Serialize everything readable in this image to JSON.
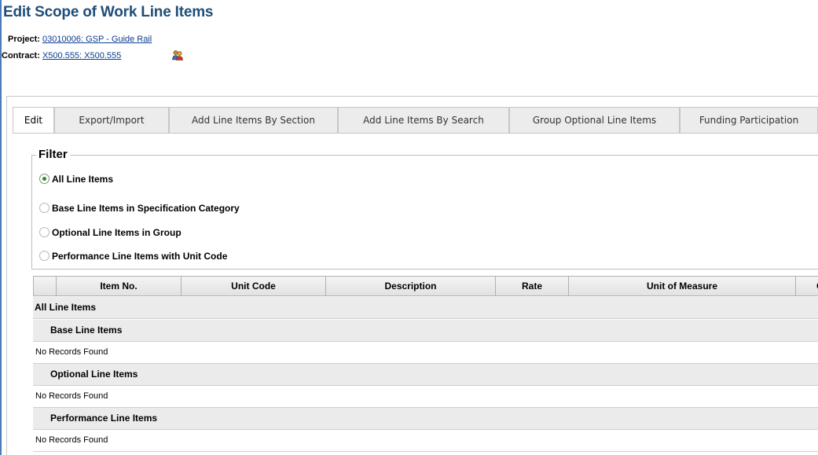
{
  "page": {
    "title": "Edit Scope of Work Line Items"
  },
  "project": {
    "label": "Project:",
    "value": "03010006: GSP - Guide Rail"
  },
  "contract": {
    "label": "Contract:",
    "value": "X500.555: X500.555",
    "icon": "contacts-icon"
  },
  "tabs": [
    {
      "label": "Edit",
      "active": true
    },
    {
      "label": "Export/Import",
      "active": false
    },
    {
      "label": "Add Line Items By Section",
      "active": false
    },
    {
      "label": "Add Line Items By Search",
      "active": false
    },
    {
      "label": "Group Optional Line Items",
      "active": false
    },
    {
      "label": "Funding Participation",
      "active": false
    }
  ],
  "filter": {
    "legend": "Filter",
    "options": [
      {
        "label": "All Line Items",
        "selected": true
      },
      {
        "label": "Base Line Items in Specification Category",
        "selected": false
      },
      {
        "label": "Optional Line Items in Group",
        "selected": false
      },
      {
        "label": "Performance Line Items with Unit Code",
        "selected": false
      }
    ]
  },
  "grid": {
    "columns": [
      "",
      "Item No.",
      "Unit Code",
      "Description",
      "Rate",
      "Unit of Measure",
      "C"
    ],
    "groups": {
      "all": "All Line Items",
      "base": "Base Line Items",
      "optional": "Optional Line Items",
      "performance": "Performance Line Items"
    },
    "empty_text": "No Records Found"
  },
  "colors": {
    "title": "#1f4e79",
    "link": "#0b3d91",
    "radio_selected": "#2e8b2e"
  }
}
